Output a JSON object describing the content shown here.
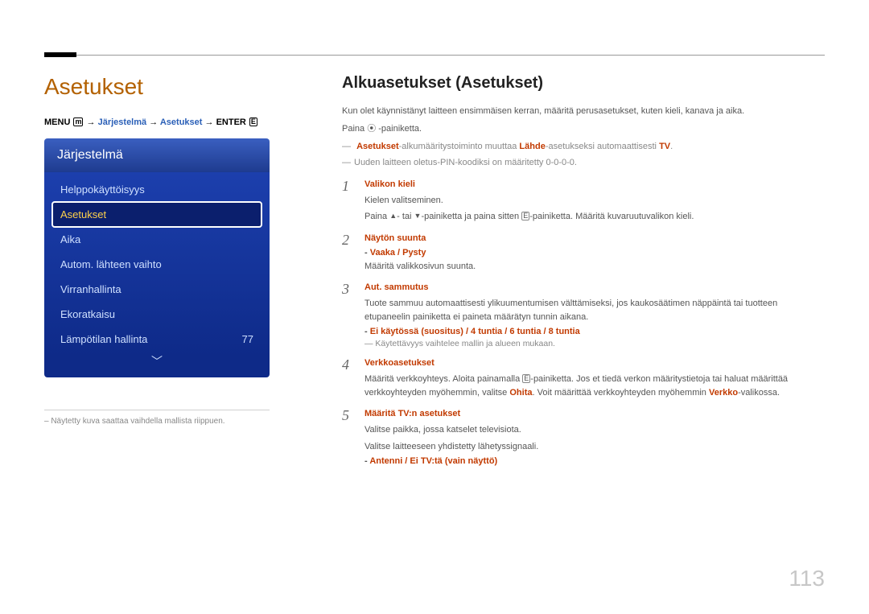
{
  "page_number": "113",
  "left": {
    "title": "Asetukset",
    "breadcrumb": {
      "menu_label": "MENU",
      "menu_icon": "m",
      "arrow": "→",
      "seg1": "Järjestelmä",
      "seg2": "Asetukset",
      "enter_label": "ENTER",
      "enter_icon": "E"
    },
    "menu": {
      "header": "Järjestelmä",
      "items": [
        {
          "label": "Helppokäyttöisyys",
          "selected": false
        },
        {
          "label": "Asetukset",
          "selected": true
        },
        {
          "label": "Aika",
          "selected": false
        },
        {
          "label": "Autom. lähteen vaihto",
          "selected": false
        },
        {
          "label": "Virranhallinta",
          "selected": false
        },
        {
          "label": "Ekoratkaisu",
          "selected": false
        },
        {
          "label": "Lämpötilan hallinta",
          "value": "77",
          "selected": false
        }
      ],
      "more_icon": "﹀"
    },
    "left_note": "– Näytetty kuva saattaa vaihdella mallista riippuen."
  },
  "right": {
    "title": "Alkuasetukset (Asetukset)",
    "intro": "Kun olet käynnistänyt laitteen ensimmäisen kerran, määritä perusasetukset, kuten kieli, kanava ja aika.",
    "press": "Paina ⦿ -painiketta.",
    "note1_pre": "Asetukset",
    "note1_mid": "-alkumääritystoiminto muuttaa ",
    "note1_l": "Lähde",
    "note1_mid2": "-asetukseksi automaattisesti ",
    "note1_tv": "TV",
    "note1_end": ".",
    "note2": "Uuden laitteen oletus-PIN-koodiksi on määritetty 0-0-0-0.",
    "steps": [
      {
        "title": "Valikon kieli",
        "body1": "Kielen valitseminen.",
        "body2_pre": "Paina ",
        "body2_up": "▲",
        "body2_mid": "- tai ",
        "body2_dn": "▼",
        "body2_mid2": "-painiketta ja paina sitten ",
        "body2_icon": "E",
        "body2_end": "-painiketta. Määritä kuvaruutuvalikon kieli."
      },
      {
        "title": "Näytön suunta",
        "sub": "Vaaka / Pysty",
        "body": "Määritä valikkosivun suunta."
      },
      {
        "title": "Aut. sammutus",
        "body": "Tuote sammuu automaattisesti ylikuumentumisen välttämiseksi, jos kaukosäätimen näppäintä tai tuotteen etupaneelin painiketta ei paineta määrätyn tunnin aikana.",
        "sub": "Ei käytössä (suositus) / 4 tuntia / 6 tuntia / 8 tuntia",
        "subnote": "Käytettävyys vaihtelee mallin ja alueen mukaan."
      },
      {
        "title": "Verkkoasetukset",
        "body_pre": "Määritä verkkoyhteys. Aloita painamalla ",
        "body_icon": "E",
        "body_mid": "-painiketta. Jos et tiedä verkon määritystietoja tai haluat määrittää verkkoyhteyden myöhemmin, valitse ",
        "body_skip": "Ohita",
        "body_mid2": ". Voit määrittää verkkoyhteyden myöhemmin ",
        "body_net": "Verkko",
        "body_end": "-valikossa."
      },
      {
        "title": "Määritä TV:n asetukset",
        "body1": "Valitse paikka, jossa katselet televisiota.",
        "body2": "Valitse laitteeseen yhdistetty lähetyssignaali.",
        "sub": "Antenni / Ei TV:tä (vain näyttö)"
      }
    ]
  }
}
